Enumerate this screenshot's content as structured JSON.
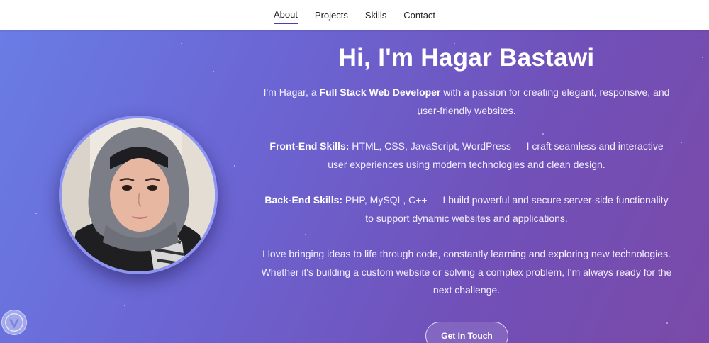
{
  "nav": {
    "items": [
      {
        "label": "About",
        "active": true
      },
      {
        "label": "Projects",
        "active": false
      },
      {
        "label": "Skills",
        "active": false
      },
      {
        "label": "Contact",
        "active": false
      }
    ]
  },
  "hero": {
    "title": "Hi, I'm Hagar Bastawi",
    "intro": {
      "prefix": "I'm Hagar, a ",
      "highlight": "Full Stack Web Developer",
      "suffix": " with a passion for creating elegant, responsive, and user-friendly websites."
    },
    "frontend": {
      "label": "Front-End Skills:",
      "text": " HTML, CSS, JavaScript, WordPress — I craft seamless and interactive user experiences using modern technologies and clean design."
    },
    "backend": {
      "label": "Back-End Skills:",
      "text": " PHP, MySQL, C++ — I build powerful and secure server-side functionality to support dynamic websites and applications."
    },
    "closing": "I love bringing ideas to life through code, constantly learning and exploring new technologies. Whether it's building a custom website or solving a complex problem, I'm always ready for the next challenge.",
    "cta_label": "Get In Touch"
  },
  "colors": {
    "accent": "#4a3fb5",
    "avatar_border": "#8e94f2"
  }
}
